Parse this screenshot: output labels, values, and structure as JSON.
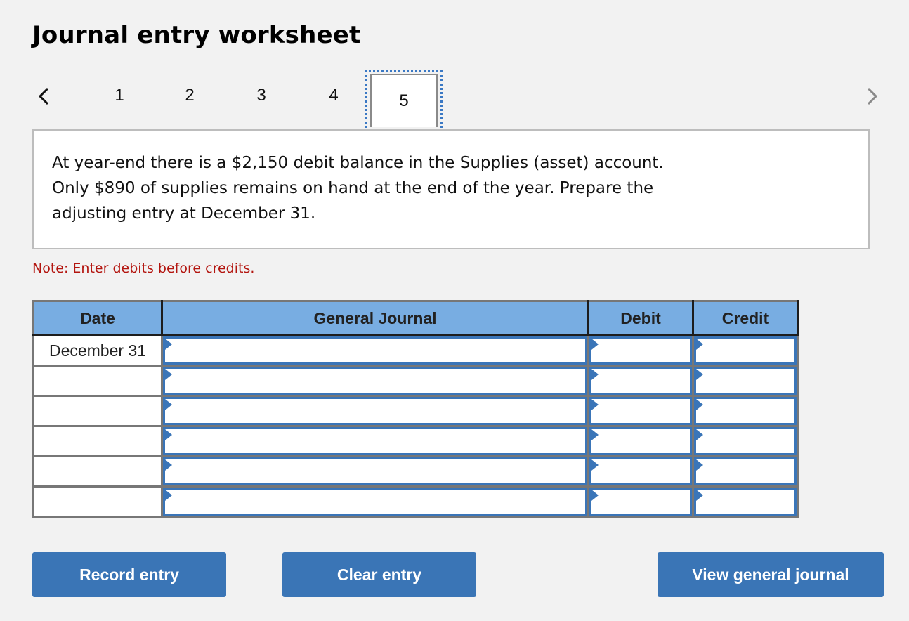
{
  "page": {
    "title": "Journal entry worksheet"
  },
  "nav": {
    "prev_icon": "chevron-left-icon",
    "next_icon": "chevron-right-icon",
    "steps": [
      "1",
      "2",
      "3",
      "4",
      "5"
    ],
    "active_step": "5"
  },
  "question": {
    "line1": "At year-end there is a $2,150 debit balance in the Supplies (asset) account.",
    "line2": "Only $890 of supplies remains on hand at the end of the year. Prepare the",
    "line3": "adjusting entry at December 31."
  },
  "note": "Note: Enter debits before credits.",
  "table": {
    "headers": {
      "date": "Date",
      "general_journal": "General Journal",
      "debit": "Debit",
      "credit": "Credit"
    },
    "rows": [
      {
        "date": "December 31",
        "account": "",
        "debit": "",
        "credit": ""
      },
      {
        "date": "",
        "account": "",
        "debit": "",
        "credit": ""
      },
      {
        "date": "",
        "account": "",
        "debit": "",
        "credit": ""
      },
      {
        "date": "",
        "account": "",
        "debit": "",
        "credit": ""
      },
      {
        "date": "",
        "account": "",
        "debit": "",
        "credit": ""
      },
      {
        "date": "",
        "account": "",
        "debit": "",
        "credit": ""
      }
    ]
  },
  "buttons": {
    "record": "Record entry",
    "clear": "Clear entry",
    "view": "View general journal"
  },
  "colors": {
    "header_bg": "#78ade2",
    "button_bg": "#3a75b6",
    "note_text": "#b3150f",
    "input_border": "#3a75b8"
  }
}
